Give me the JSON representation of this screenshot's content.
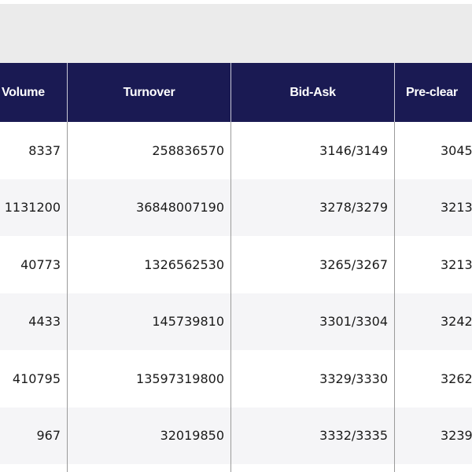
{
  "table": {
    "headers": [
      "Volume",
      "Turnover",
      "Bid-Ask",
      "Pre-clear"
    ],
    "rows": [
      [
        "8337",
        "258836570",
        "3146/3149",
        "3045"
      ],
      [
        "1131200",
        "36848007190",
        "3278/3279",
        "3213"
      ],
      [
        "40773",
        "1326562530",
        "3265/3267",
        "3213"
      ],
      [
        "4433",
        "145739810",
        "3301/3304",
        "3242"
      ],
      [
        "410795",
        "13597319800",
        "3329/3330",
        "3262"
      ],
      [
        "967",
        "32019850",
        "3332/3335",
        "3239"
      ]
    ]
  },
  "colors": {
    "header_bg": "#1a1a53",
    "header_text": "#ffffff",
    "top_band": "#ebebeb",
    "row_alt": "#f5f5f7"
  }
}
